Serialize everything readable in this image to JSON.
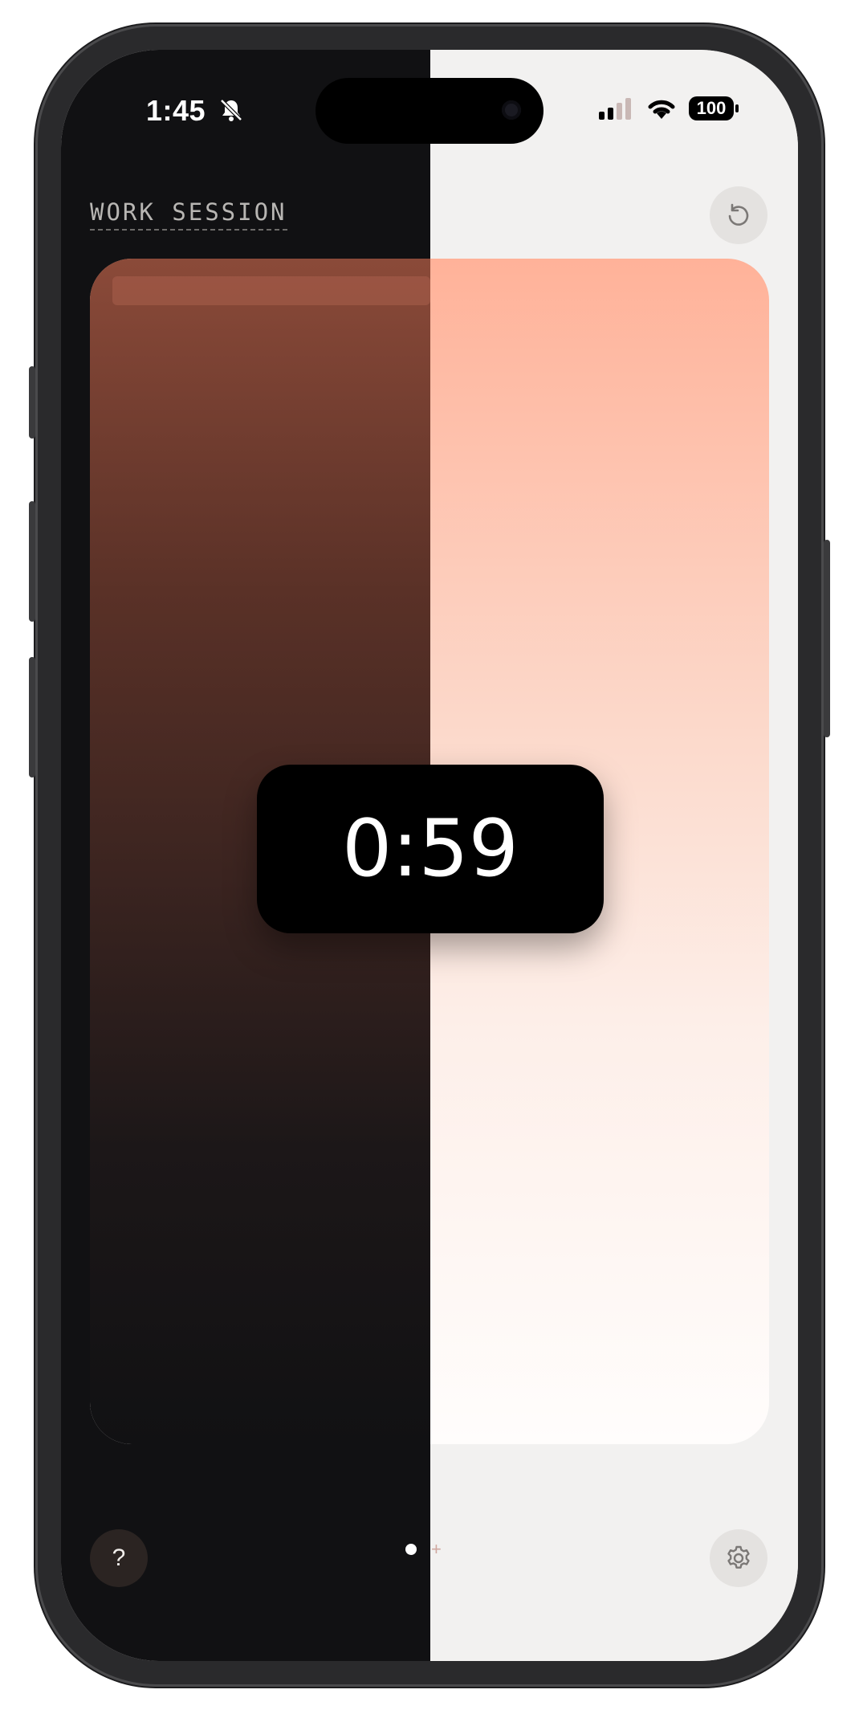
{
  "status_bar": {
    "time": "1:45",
    "battery": "100"
  },
  "session": {
    "label": "WORK SESSION"
  },
  "timer": {
    "display": "0:59"
  },
  "controls": {
    "help_label": "?",
    "pager_add": "+"
  },
  "icons": {
    "reset": "reset-icon",
    "settings": "gear-icon",
    "bell_off": "bell-slash-icon",
    "signal": "cellular-signal-icon",
    "wifi": "wifi-icon"
  },
  "colors": {
    "dark_bg": "#111113",
    "light_bg": "#f2f1f0",
    "accent_peach": "#ffb299",
    "timer_bg": "#000000"
  }
}
